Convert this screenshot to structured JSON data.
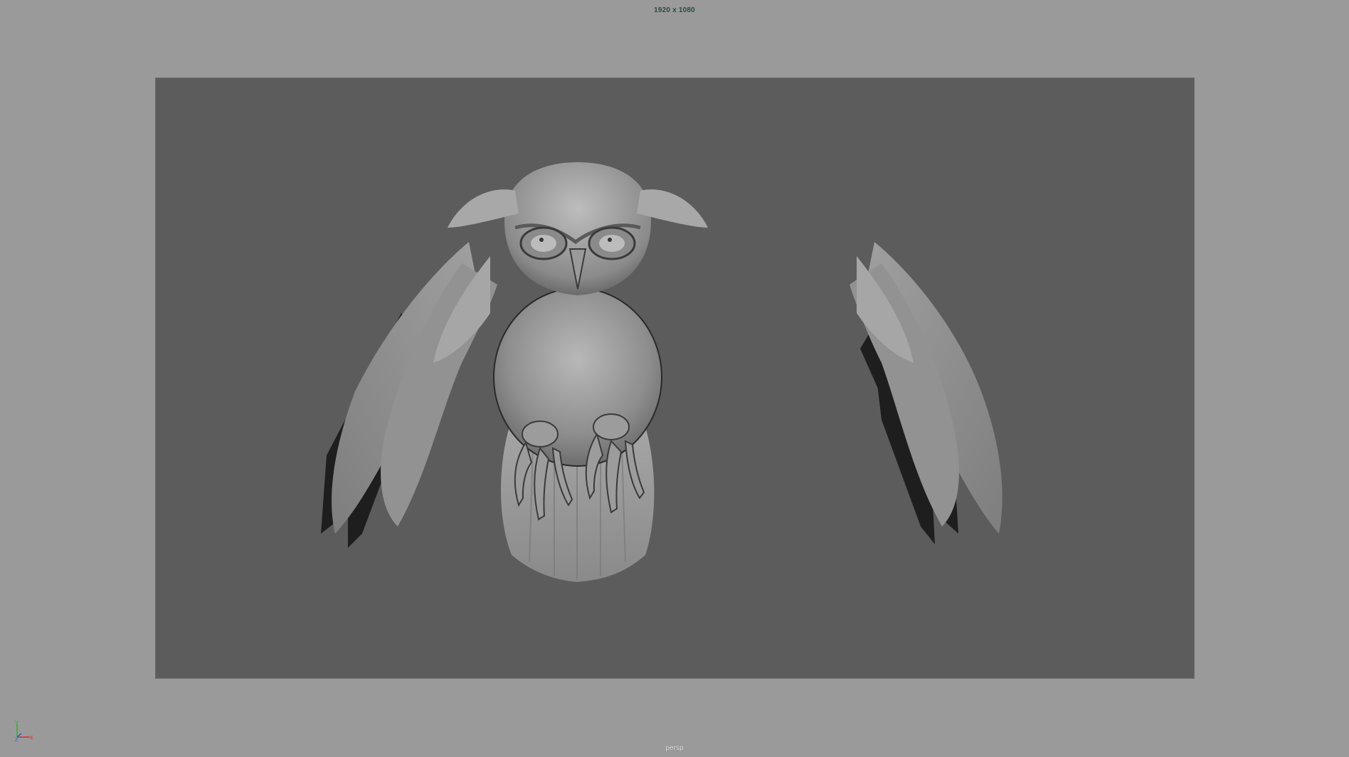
{
  "viewport": {
    "resolution_text": "1920 x 1080",
    "camera_name": "persp",
    "background_color": "#9a9a9a",
    "gate_color": "#5c5c5c"
  },
  "axis_gizmo": {
    "x_label": "X",
    "y_label": "Y",
    "z_label": "Z",
    "x_color": "#d03030",
    "y_color": "#30b030",
    "z_color": "#3060d0"
  },
  "model": {
    "icon": "owl-model"
  }
}
